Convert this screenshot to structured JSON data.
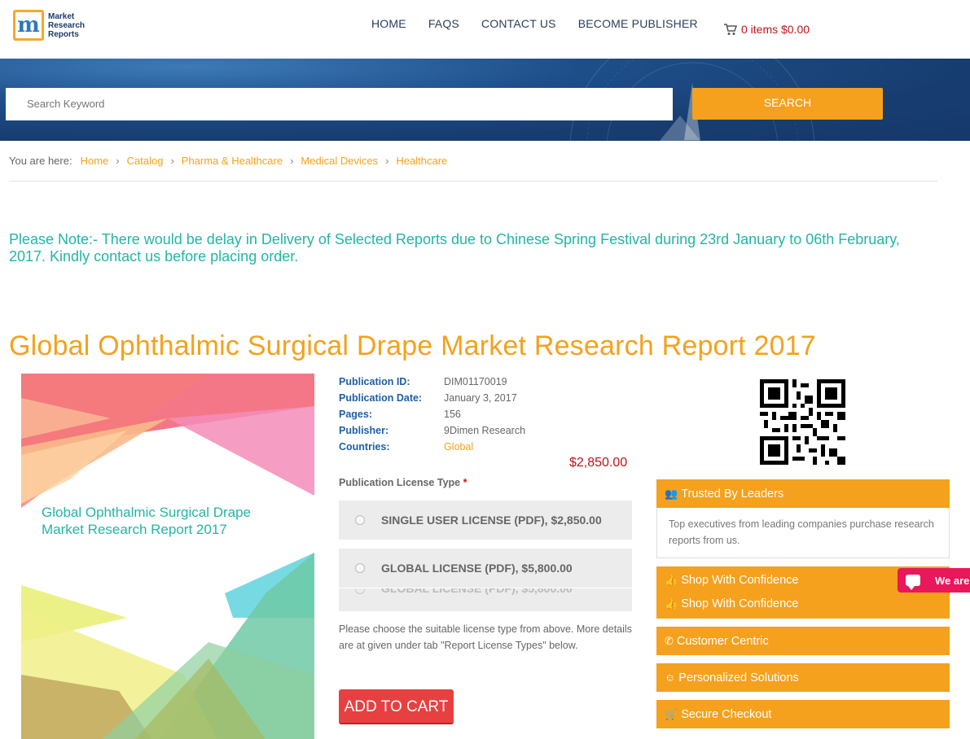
{
  "brand": {
    "logo_letter": "m",
    "line1": "Market",
    "line2": "Research",
    "line3": "Reports"
  },
  "nav": {
    "items": [
      "HOME",
      "FAQS",
      "CONTACT US",
      "BECOME PUBLISHER"
    ]
  },
  "cart": {
    "label": "0 items $0.00"
  },
  "search": {
    "placeholder": "Search Keyword",
    "button": "SEARCH"
  },
  "breadcrumb": {
    "label": "You are here:",
    "items": [
      "Home",
      "Catalog",
      "Pharma & Healthcare",
      "Medical Devices",
      "Healthcare"
    ]
  },
  "notice": "Please Note:- There would be delay in Delivery of Selected Reports due to Chinese Spring Festival during 23rd January to 06th February, 2017. Kindly contact us before placing order.",
  "report": {
    "title": "Global Ophthalmic Surgical Drape Market Research Report 2017",
    "cover_title": "Global Ophthalmic Surgical Drape Market Research Report 2017",
    "details": [
      {
        "key": "Publication ID:",
        "value": "DIM01170019"
      },
      {
        "key": "Publication Date:",
        "value": "January 3, 2017"
      },
      {
        "key": "Pages:",
        "value": "156"
      },
      {
        "key": "Publisher:",
        "value": "9Dimen Research"
      },
      {
        "key": "Countries:",
        "value": "Global"
      }
    ],
    "price": "$2,850.00",
    "license_label": "Publication License Type",
    "license_required": "*",
    "licenses": [
      "SINGLE USER LICENSE (PDF), $2,850.00",
      "GLOBAL LICENSE (PDF), $5,800.00"
    ],
    "choose_text": "Please choose the suitable license type from above. More details are at given under tab \"Report License Types\" below.",
    "add_to_cart": "ADD TO CART"
  },
  "sidebar": {
    "trusted_title": "Trusted By Leaders",
    "trusted_body": "Top executives from leading companies purchase research reports from us.",
    "shop1": "Shop With Confidence",
    "shop2": "Shop With Confidence",
    "customer": "Customer Centric",
    "personalized": "Personalized Solutions",
    "secure": "Secure Checkout"
  },
  "chat": {
    "label": "We are"
  },
  "colors": {
    "accent": "#f5a11d",
    "teal": "#23b5a6",
    "price": "#c0131a",
    "navy": "#173d70",
    "cart_btn": "#e84040"
  }
}
